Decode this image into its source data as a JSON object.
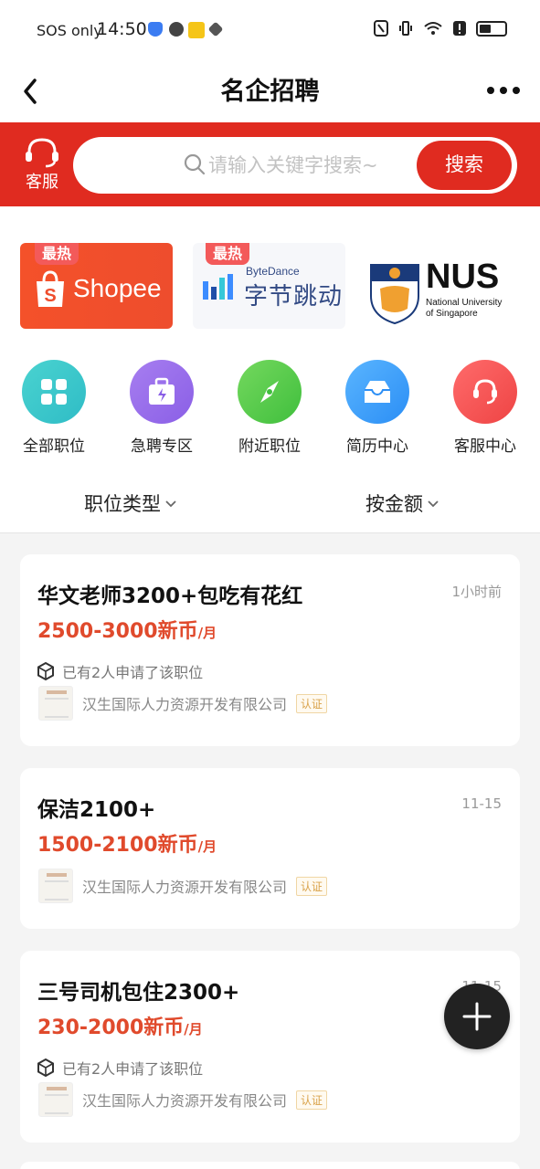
{
  "status_bar": {
    "carrier": "SOS only",
    "time": "14:50"
  },
  "header": {
    "title": "名企招聘"
  },
  "search": {
    "customer_service_label": "客服",
    "placeholder": "请输入关键字搜索~",
    "button_label": "搜索"
  },
  "featured": [
    {
      "name": "Shopee",
      "badge": "最热"
    },
    {
      "name_en": "ByteDance",
      "name_cn": "字节跳动",
      "badge": "最热"
    },
    {
      "name": "NUS",
      "subtitle_line1": "National University",
      "subtitle_line2": "of Singapore"
    }
  ],
  "quick_links": [
    {
      "label": "全部职位",
      "icon": "grid-icon"
    },
    {
      "label": "急聘专区",
      "icon": "urgent-briefcase-icon"
    },
    {
      "label": "附近职位",
      "icon": "compass-icon"
    },
    {
      "label": "简历中心",
      "icon": "inbox-icon"
    },
    {
      "label": "客服中心",
      "icon": "headset-icon"
    }
  ],
  "filters": {
    "type_label": "职位类型",
    "salary_label": "按金额"
  },
  "jobs": [
    {
      "title": "华文老师3200+包吃有花红",
      "time": "1小时前",
      "salary": "2500-3000新币",
      "unit": "/月",
      "applied": "已有2人申请了该职位",
      "company": "汉生国际人力资源开发有限公司",
      "verified": "认证"
    },
    {
      "title": "保洁2100+",
      "time": "11-15",
      "salary": "1500-2100新币",
      "unit": "/月",
      "company": "汉生国际人力资源开发有限公司",
      "verified": "认证"
    },
    {
      "title": "三号司机包住2300+",
      "time": "11-15",
      "salary": "230-2000新币",
      "unit": "/月",
      "applied": "已有2人申请了该职位",
      "company": "汉生国际人力资源开发有限公司",
      "verified": "认证"
    }
  ],
  "colors": {
    "brand_red": "#e02b20",
    "salary_red": "#e04a2c"
  }
}
